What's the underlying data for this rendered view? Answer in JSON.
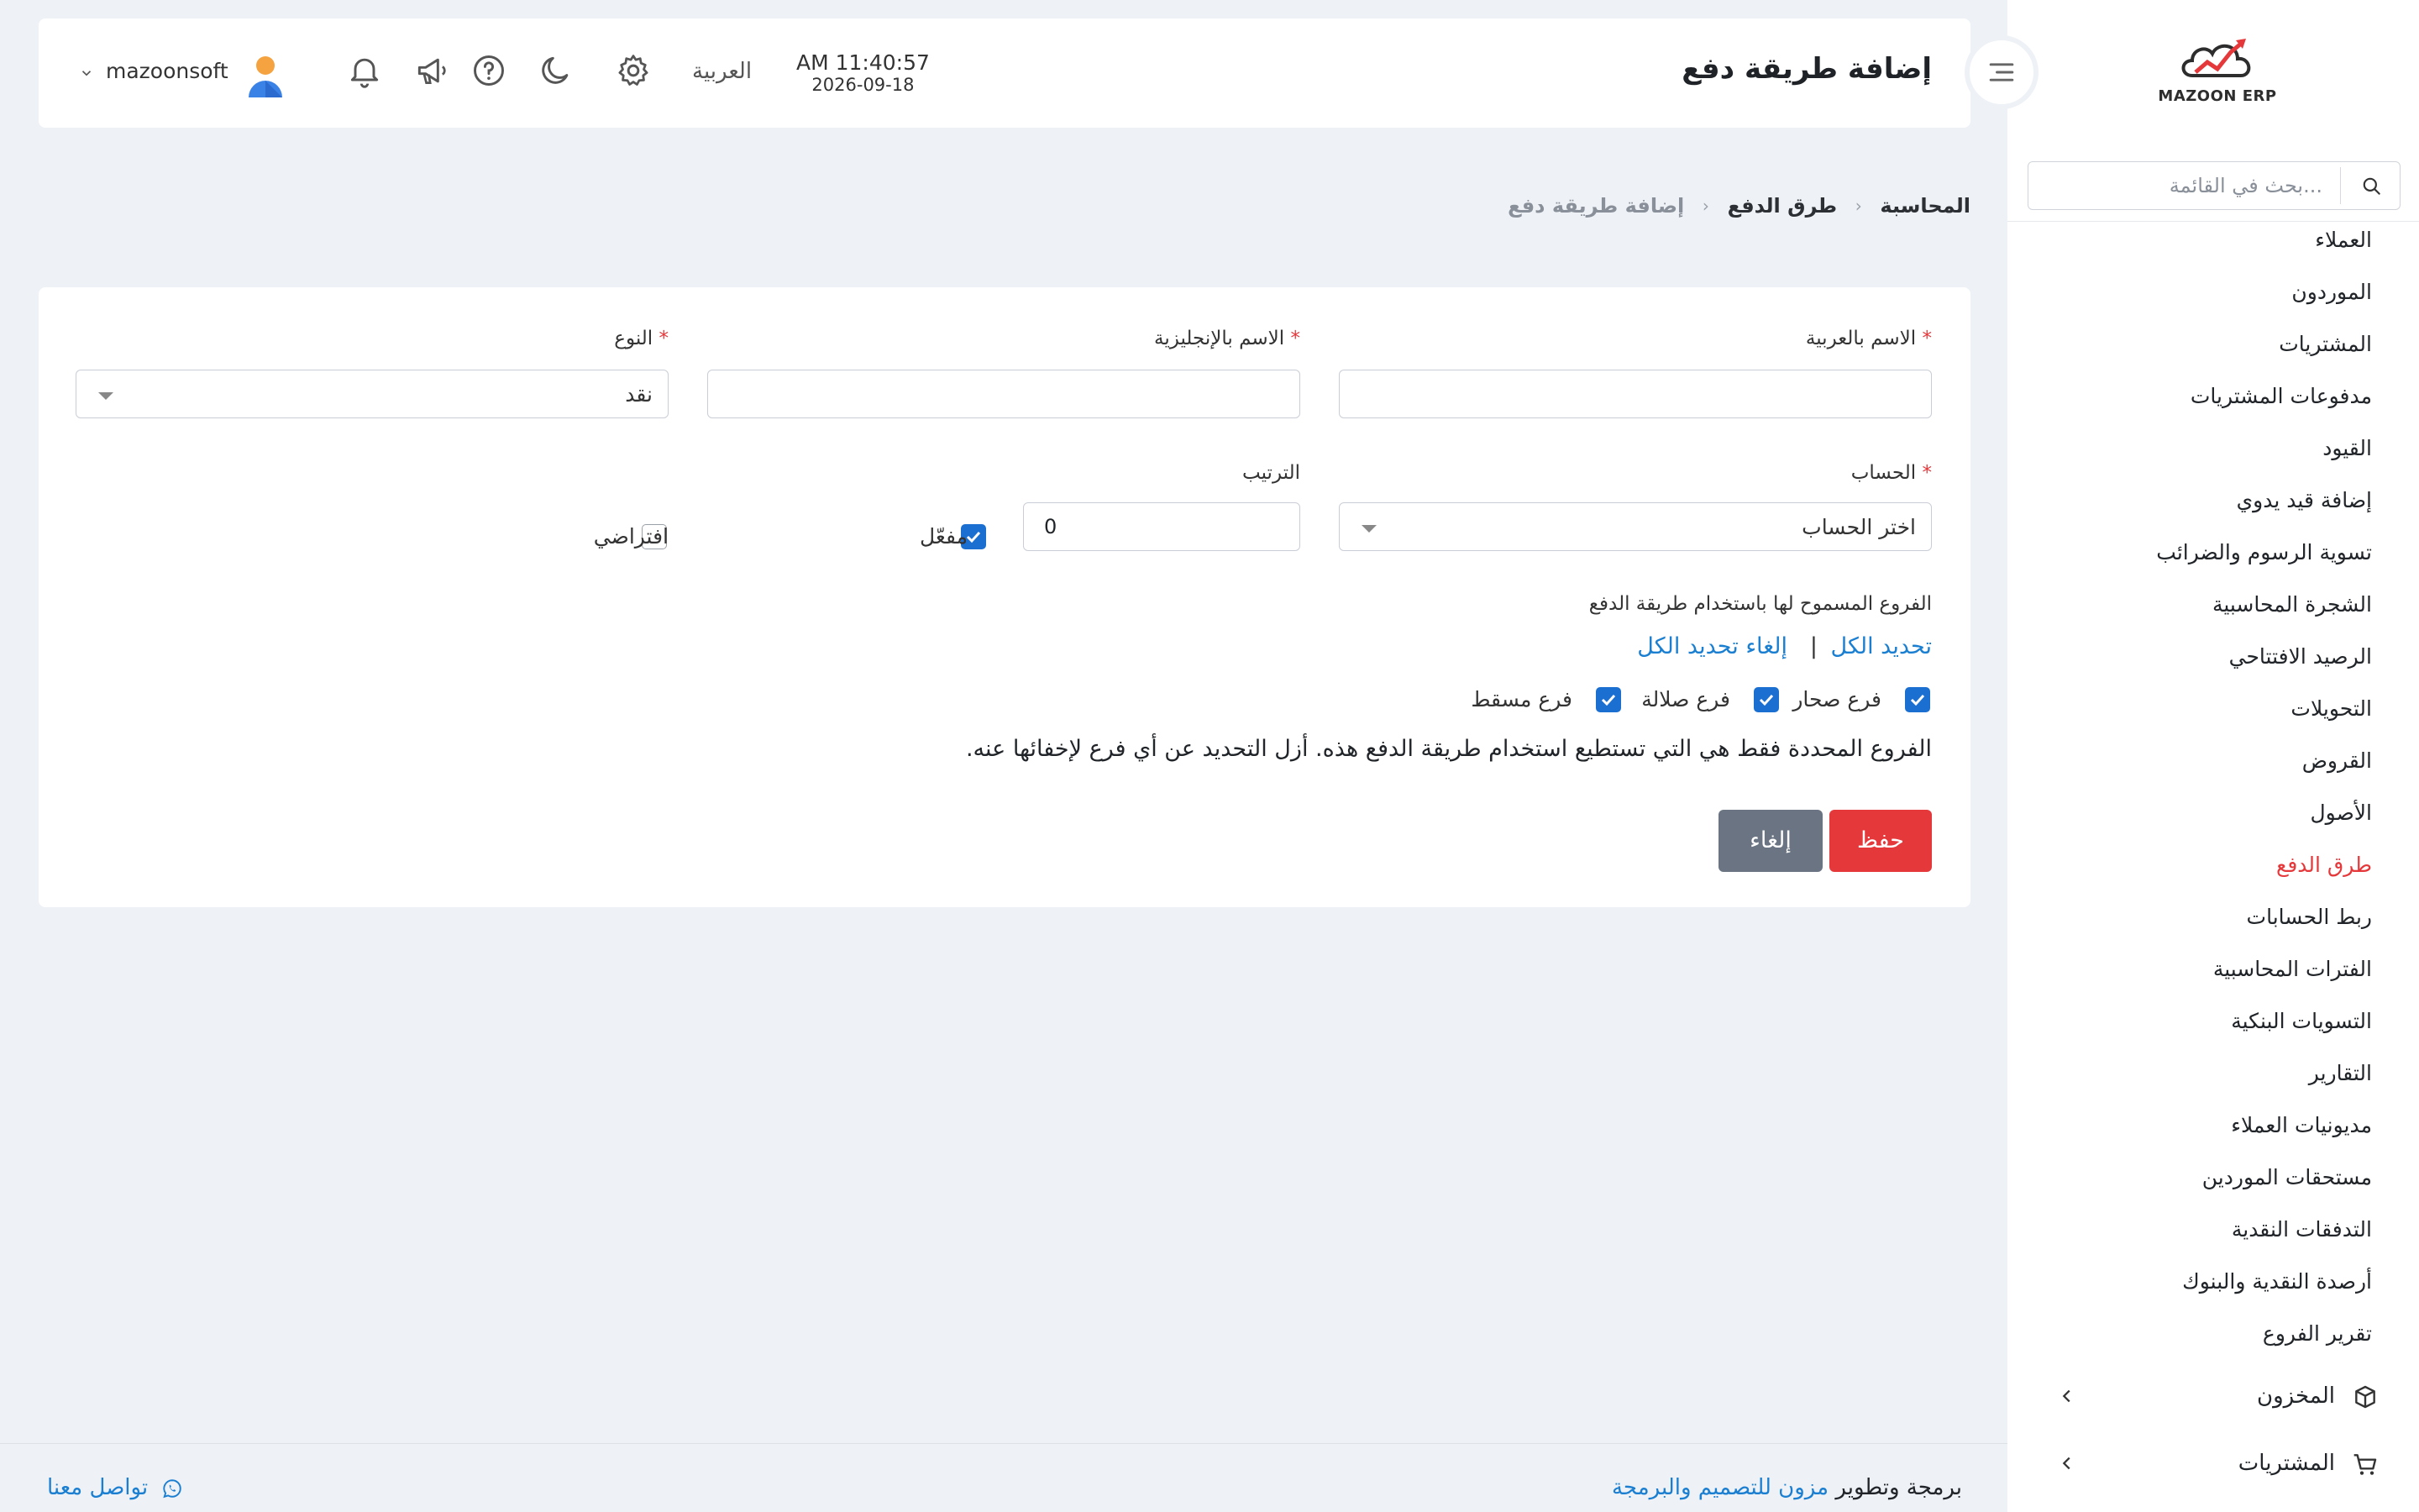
{
  "brand": {
    "logo_text": "MAZOON ERP"
  },
  "sidebar": {
    "search_placeholder": "بحث في القائمة...",
    "items": [
      {
        "label": "العملاء"
      },
      {
        "label": "الموردون"
      },
      {
        "label": "المشتريات"
      },
      {
        "label": "مدفوعات المشتريات"
      },
      {
        "label": "القيود"
      },
      {
        "label": "إضافة قيد يدوي"
      },
      {
        "label": "تسوية الرسوم والضرائب"
      },
      {
        "label": "الشجرة المحاسبية"
      },
      {
        "label": "الرصيد الافتتاحي"
      },
      {
        "label": "التحويلات"
      },
      {
        "label": "القروض"
      },
      {
        "label": "الأصول"
      },
      {
        "label": "طرق الدفع",
        "active": true
      },
      {
        "label": "ربط الحسابات"
      },
      {
        "label": "الفترات المحاسبية"
      },
      {
        "label": "التسويات البنكية"
      },
      {
        "label": "التقارير"
      },
      {
        "label": "مديونيات العملاء"
      },
      {
        "label": "مستحقات الموردين"
      },
      {
        "label": "التدفقات النقدية"
      },
      {
        "label": "أرصدة النقدية والبنوك"
      },
      {
        "label": "تقرير الفروع"
      }
    ],
    "groups": [
      {
        "label": "المخزون",
        "icon": "box-icon"
      },
      {
        "label": "المشتريات",
        "icon": "cart-icon"
      }
    ]
  },
  "header": {
    "title": "إضافة طريقة دفع",
    "time": "AM 11:40:57",
    "date": "2026-09-18",
    "language": "العربية",
    "username": "mazoonsoft"
  },
  "breadcrumb": {
    "items": [
      "المحاسبة",
      "طرق الدفع"
    ],
    "current": "إضافة طريقة دفع"
  },
  "form": {
    "name_ar_label": "الاسم بالعربية",
    "name_ar_value": "",
    "name_en_label": "الاسم بالإنجليزية",
    "name_en_value": "",
    "type_label": "النوع",
    "type_value": "نقد",
    "account_label": "الحساب",
    "account_value": "اختر الحساب",
    "order_label": "الترتيب",
    "order_value": "0",
    "enabled_label": "مفعّل",
    "enabled": true,
    "default_label": "افتراضي",
    "default": false,
    "required_mark": "*",
    "branches_label": "الفروع المسموح لها باستخدام طريقة الدفع",
    "select_all": "تحديد الكل",
    "separator": "|",
    "deselect_all": "إلغاء تحديد الكل",
    "branches": [
      {
        "label": "فرع صحار",
        "checked": true
      },
      {
        "label": "فرع صلالة",
        "checked": true
      },
      {
        "label": "فرع مسقط",
        "checked": true
      }
    ],
    "note": "الفروع المحددة فقط هي التي تستطيع استخدام طريقة الدفع هذه. أزل التحديد عن أي فرع لإخفائها عنه.",
    "save": "حفظ",
    "cancel": "إلغاء"
  },
  "footer": {
    "credit_prefix": "برمجة وتطوير",
    "credit_brand": "مزون للتصميم والبرمجة",
    "contact": "تواصل معنا"
  },
  "colors": {
    "accent": "#e5383b",
    "link": "#1b7fd1",
    "checkbox": "#1b6fd1",
    "cancel": "#6a7482"
  }
}
